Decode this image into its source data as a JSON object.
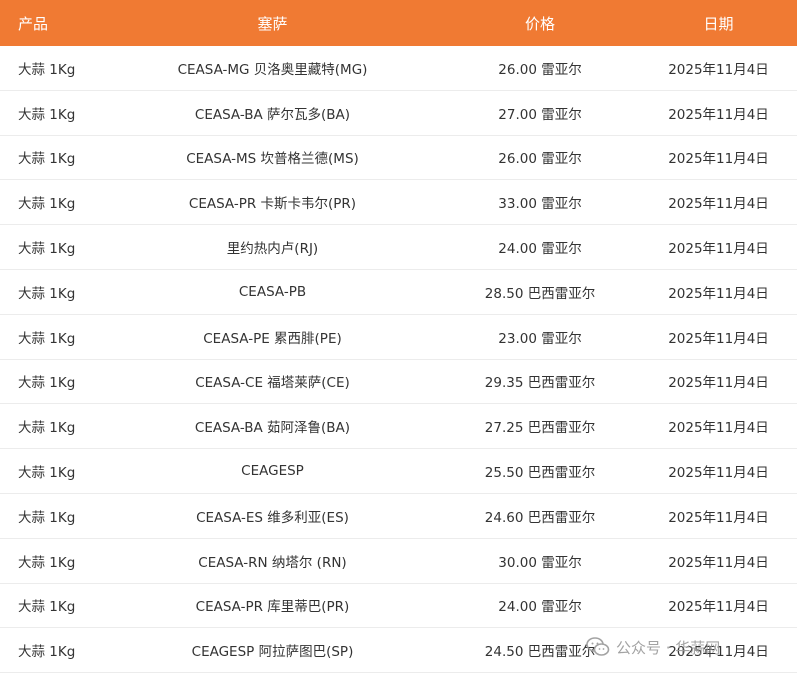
{
  "header": {
    "product": "产品",
    "ceasa": "塞萨",
    "price": "价格",
    "date": "日期"
  },
  "rows": [
    {
      "product": "大蒜 1Kg",
      "ceasa": "CEASA-MG 贝洛奥里藏特(MG)",
      "price": "26.00 雷亚尔",
      "date": "2025年11月4日"
    },
    {
      "product": "大蒜 1Kg",
      "ceasa": "CEASA-BA 萨尔瓦多(BA)",
      "price": "27.00 雷亚尔",
      "date": "2025年11月4日"
    },
    {
      "product": "大蒜 1Kg",
      "ceasa": "CEASA-MS 坎普格兰德(MS)",
      "price": "26.00 雷亚尔",
      "date": "2025年11月4日"
    },
    {
      "product": "大蒜 1Kg",
      "ceasa": "CEASA-PR 卡斯卡韦尔(PR)",
      "price": "33.00 雷亚尔",
      "date": "2025年11月4日"
    },
    {
      "product": "大蒜 1Kg",
      "ceasa": "里约热内卢(RJ)",
      "price": "24.00 雷亚尔",
      "date": "2025年11月4日"
    },
    {
      "product": "大蒜 1Kg",
      "ceasa": "CEASA-PB",
      "price": "28.50 巴西雷亚尔",
      "date": "2025年11月4日"
    },
    {
      "product": "大蒜 1Kg",
      "ceasa": "CEASA-PE 累西腓(PE)",
      "price": "23.00 雷亚尔",
      "date": "2025年11月4日"
    },
    {
      "product": "大蒜 1Kg",
      "ceasa": "CEASA-CE 福塔莱萨(CE)",
      "price": "29.35 巴西雷亚尔",
      "date": "2025年11月4日"
    },
    {
      "product": "大蒜 1Kg",
      "ceasa": "CEASA-BA 茹阿泽鲁(BA)",
      "price": "27.25 巴西雷亚尔",
      "date": "2025年11月4日"
    },
    {
      "product": "大蒜 1Kg",
      "ceasa": "CEAGESP",
      "price": "25.50 巴西雷亚尔",
      "date": "2025年11月4日"
    },
    {
      "product": "大蒜 1Kg",
      "ceasa": "CEASA-ES 维多利亚(ES)",
      "price": "24.60 巴西雷亚尔",
      "date": "2025年11月4日"
    },
    {
      "product": "大蒜 1Kg",
      "ceasa": "CEASA-RN 纳塔尔 (RN)",
      "price": "30.00 雷亚尔",
      "date": "2025年11月4日"
    },
    {
      "product": "大蒜 1Kg",
      "ceasa": "CEASA-PR 库里蒂巴(PR)",
      "price": "24.00 雷亚尔",
      "date": "2025年11月4日"
    },
    {
      "product": "大蒜 1Kg",
      "ceasa": "CEAGESP 阿拉萨图巴(SP)",
      "price": "24.50 巴西雷亚尔",
      "date": "2025年11月4日"
    }
  ],
  "watermark": {
    "text": "公众号 · 华蒜网",
    "icon": "wechat-icon"
  },
  "colors": {
    "header_bg": "#f07a33",
    "header_text": "#ffffff",
    "body_text": "#333333",
    "row_border": "#ececec"
  }
}
